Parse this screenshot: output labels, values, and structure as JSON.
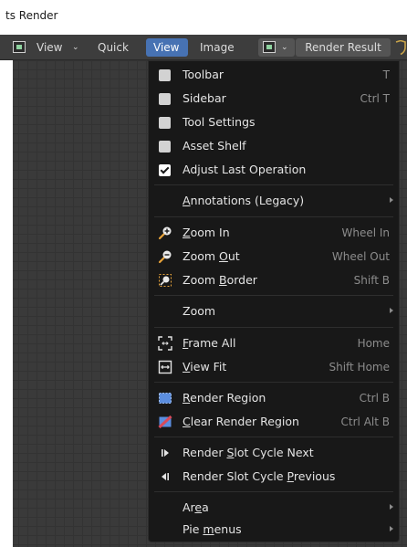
{
  "window": {
    "title": "ts Render"
  },
  "header": {
    "view_left_label": "View",
    "quick_label": "Quick",
    "view_label": "View",
    "image_label": "Image",
    "render_result_label": "Render Result"
  },
  "menu": {
    "toolbar": {
      "label": "Toolbar",
      "shortcut": "T",
      "checked": false
    },
    "sidebar": {
      "label": "Sidebar",
      "shortcut": "Ctrl T",
      "checked": false
    },
    "tool_settings": {
      "label": "Tool Settings",
      "checked": false
    },
    "asset_shelf": {
      "label": "Asset Shelf",
      "checked": false
    },
    "adjust_last": {
      "label": "Adjust Last Operation",
      "checked": true
    },
    "annotations": {
      "label_pre": "",
      "label_key": "A",
      "label_post": "nnotations (Legacy)",
      "submenu": true
    },
    "zoom_in": {
      "label_pre": "",
      "label_key": "Z",
      "label_post": "oom In",
      "shortcut": "Wheel In",
      "icon": "zoom-in-icon"
    },
    "zoom_out": {
      "label_pre": "Zoom ",
      "label_key": "O",
      "label_post": "ut",
      "shortcut": "Wheel Out",
      "icon": "zoom-out-icon"
    },
    "zoom_border": {
      "label_pre": "Zoom ",
      "label_key": "B",
      "label_post": "order",
      "shortcut": "Shift B",
      "icon": "zoom-border-icon"
    },
    "zoom": {
      "label": "Zoom",
      "submenu": true
    },
    "frame_all": {
      "label_pre": "",
      "label_key": "F",
      "label_post": "rame All",
      "shortcut": "Home",
      "icon": "frame-all-icon"
    },
    "view_fit": {
      "label_pre": "",
      "label_key": "V",
      "label_post": "iew Fit",
      "shortcut": "Shift Home",
      "icon": "view-fit-icon"
    },
    "render_region": {
      "label_pre": "",
      "label_key": "R",
      "label_post": "ender Region",
      "shortcut": "Ctrl B",
      "icon": "render-region-icon"
    },
    "clear_render_region": {
      "label_pre": "",
      "label_key": "C",
      "label_post": "lear Render Region",
      "shortcut": "Ctrl Alt B",
      "icon": "clear-render-region-icon"
    },
    "slot_next": {
      "label_pre": "Render ",
      "label_key": "S",
      "label_post": "lot Cycle Next",
      "icon": "next-frame-icon"
    },
    "slot_prev": {
      "label_pre": "Render Slot Cycle ",
      "label_key": "P",
      "label_post": "revious",
      "icon": "previous-frame-icon"
    },
    "area": {
      "label_pre": "Ar",
      "label_key": "e",
      "label_post": "a",
      "submenu": true
    },
    "pie_menus": {
      "label_pre": "Pie ",
      "label_key": "m",
      "label_post": "enus",
      "submenu": true
    }
  },
  "colors": {
    "menu_bg": "#181818",
    "header_bg": "#3d3d3d",
    "active_accent": "#4772b3",
    "region_blue": "#5b8ee0",
    "clear_red": "#d94a5a"
  }
}
